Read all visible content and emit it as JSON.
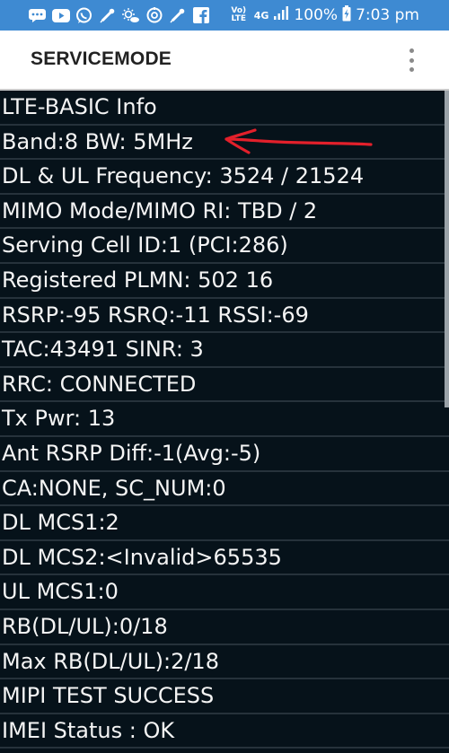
{
  "status_bar": {
    "left_icons": [
      "chat-icon",
      "youtube-icon",
      "whatsapp-icon",
      "pen-icon",
      "weather-icon",
      "sync-icon",
      "pen-icon",
      "facebook-icon"
    ],
    "volte": "Vo) LTE",
    "network": "4G",
    "battery": "100%",
    "time": "7:03 pm"
  },
  "app_bar": {
    "title": "SERVICEMODE",
    "menu_icon": "more-vert-icon"
  },
  "rows": [
    "LTE-BASIC Info",
    "Band:8 BW: 5MHz",
    "DL & UL Frequency: 3524 / 21524",
    "MIMO Mode/MIMO RI: TBD / 2",
    "Serving Cell ID:1 (PCI:286)",
    "Registered PLMN: 502 16",
    "RSRP:-95 RSRQ:-11 RSSI:-69",
    "TAC:43491 SINR: 3",
    "RRC: CONNECTED",
    "Tx Pwr: 13",
    "Ant RSRP Diff:-1(Avg:-5)",
    "CA:NONE, SC_NUM:0",
    "DL MCS1:2",
    "DL MCS2:<Invalid>65535",
    "UL MCS1:0",
    "RB(DL/UL):0/18",
    "Max RB(DL/UL):2/18",
    "MIPI TEST SUCCESS",
    "IMEI Status : OK"
  ],
  "colors": {
    "status_bar": "#3e8ad2",
    "content_bg": "#06121a",
    "annotation": "#e3202b"
  }
}
